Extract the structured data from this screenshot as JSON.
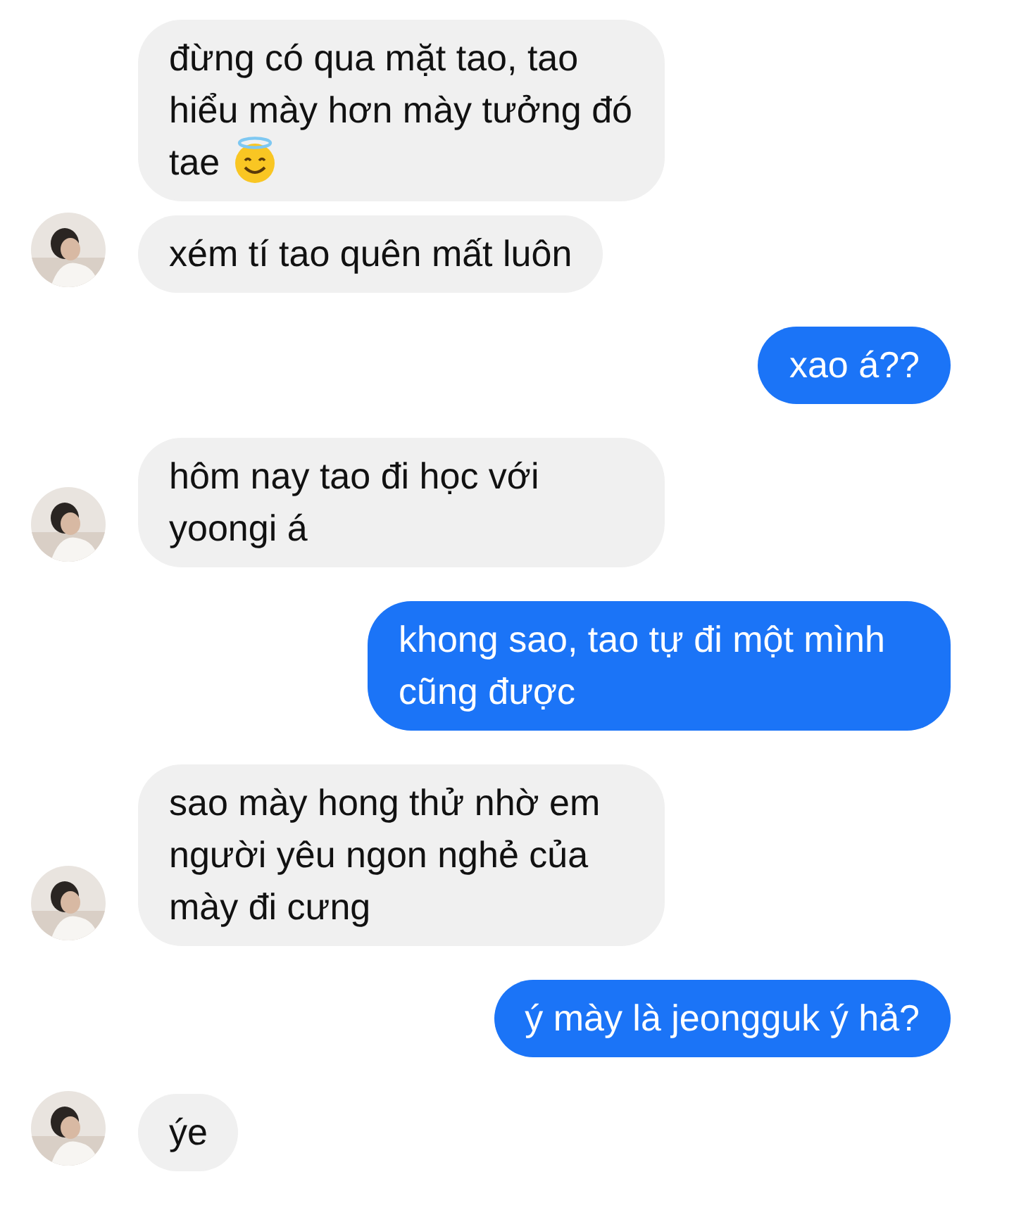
{
  "messages": [
    {
      "kind": "incoming",
      "avatar": false,
      "text": "đừng có qua mặt tao, tao hiểu mày hơn mày tưởng đó tae",
      "emoji": true
    },
    {
      "kind": "incoming",
      "avatar": true,
      "text": "xém tí tao quên mất luôn"
    },
    {
      "kind": "outgoing",
      "text": "xao á??"
    },
    {
      "kind": "incoming",
      "avatar": true,
      "text": "hôm nay tao đi học với yoongi á"
    },
    {
      "kind": "outgoing",
      "text": "khong sao, tao tự đi một mình cũng được"
    },
    {
      "kind": "incoming",
      "avatar": true,
      "text": "sao mày hong thử nhờ em người yêu ngon nghẻ của mày đi cưng"
    },
    {
      "kind": "outgoing",
      "text": "ý mày là jeongguk ý hả?"
    },
    {
      "kind": "incoming",
      "avatar": true,
      "text": "ýe"
    }
  ]
}
